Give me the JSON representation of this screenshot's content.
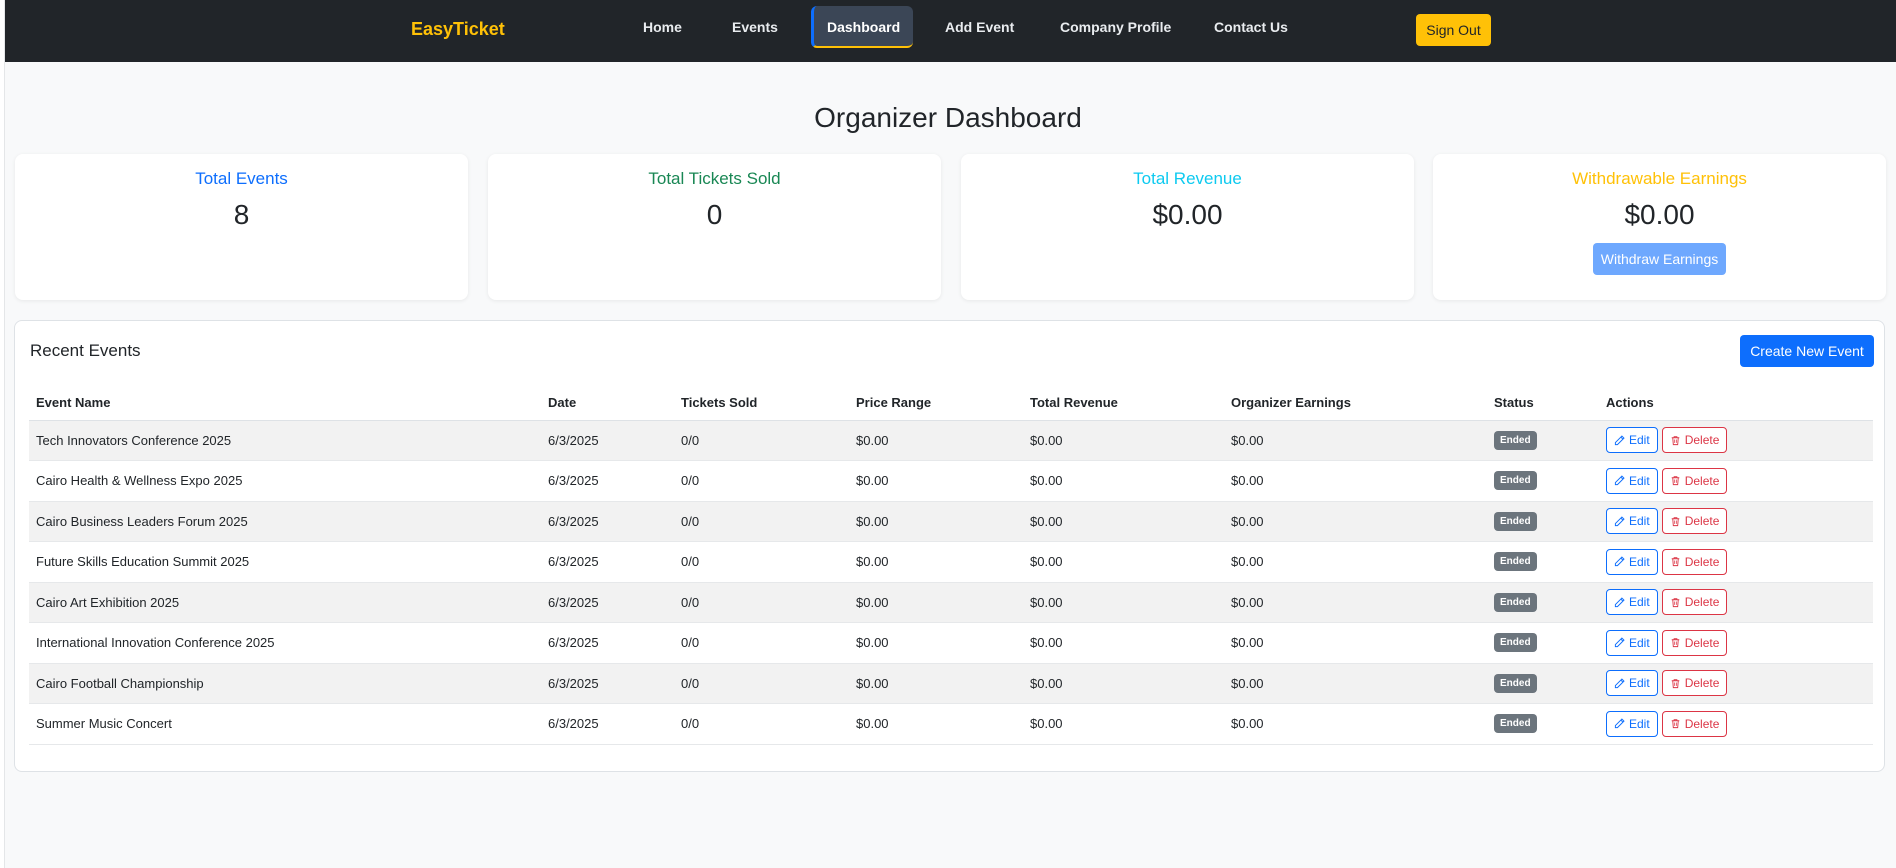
{
  "navbar": {
    "brand": "EasyTicket",
    "links": [
      {
        "label": "Home"
      },
      {
        "label": "Events"
      },
      {
        "label": "Dashboard",
        "active": true
      },
      {
        "label": "Add Event"
      },
      {
        "label": "Company Profile"
      },
      {
        "label": "Contact Us"
      }
    ],
    "signout_label": "Sign Out"
  },
  "page_title": "Organizer Dashboard",
  "stats": [
    {
      "title": "Total Events",
      "value": "8",
      "color": "#0d6efd"
    },
    {
      "title": "Total Tickets Sold",
      "value": "0",
      "color": "#198754"
    },
    {
      "title": "Total Revenue",
      "value": "$0.00",
      "color": "#0dcaf0"
    },
    {
      "title": "Withdrawable Earnings",
      "value": "$0.00",
      "color": "#ffc107",
      "button": "Withdraw Earnings"
    }
  ],
  "recent_events": {
    "heading": "Recent Events",
    "create_label": "Create New Event",
    "columns": [
      "Event Name",
      "Date",
      "Tickets Sold",
      "Price Range",
      "Total Revenue",
      "Organizer Earnings",
      "Status",
      "Actions"
    ],
    "edit_label": "Edit",
    "delete_label": "Delete",
    "rows": [
      {
        "name": "Tech Innovators Conference 2025",
        "date": "6/3/2025",
        "tickets": "0/0",
        "price": "$0.00",
        "revenue": "$0.00",
        "earnings": "$0.00",
        "status": "Ended"
      },
      {
        "name": "Cairo Health & Wellness Expo 2025",
        "date": "6/3/2025",
        "tickets": "0/0",
        "price": "$0.00",
        "revenue": "$0.00",
        "earnings": "$0.00",
        "status": "Ended"
      },
      {
        "name": "Cairo Business Leaders Forum 2025",
        "date": "6/3/2025",
        "tickets": "0/0",
        "price": "$0.00",
        "revenue": "$0.00",
        "earnings": "$0.00",
        "status": "Ended"
      },
      {
        "name": "Future Skills Education Summit 2025",
        "date": "6/3/2025",
        "tickets": "0/0",
        "price": "$0.00",
        "revenue": "$0.00",
        "earnings": "$0.00",
        "status": "Ended"
      },
      {
        "name": "Cairo Art Exhibition 2025",
        "date": "6/3/2025",
        "tickets": "0/0",
        "price": "$0.00",
        "revenue": "$0.00",
        "earnings": "$0.00",
        "status": "Ended"
      },
      {
        "name": "International Innovation Conference 2025",
        "date": "6/3/2025",
        "tickets": "0/0",
        "price": "$0.00",
        "revenue": "$0.00",
        "earnings": "$0.00",
        "status": "Ended"
      },
      {
        "name": "Cairo Football Championship",
        "date": "6/3/2025",
        "tickets": "0/0",
        "price": "$0.00",
        "revenue": "$0.00",
        "earnings": "$0.00",
        "status": "Ended"
      },
      {
        "name": "Summer Music Concert",
        "date": "6/3/2025",
        "tickets": "0/0",
        "price": "$0.00",
        "revenue": "$0.00",
        "earnings": "$0.00",
        "status": "Ended"
      }
    ]
  }
}
